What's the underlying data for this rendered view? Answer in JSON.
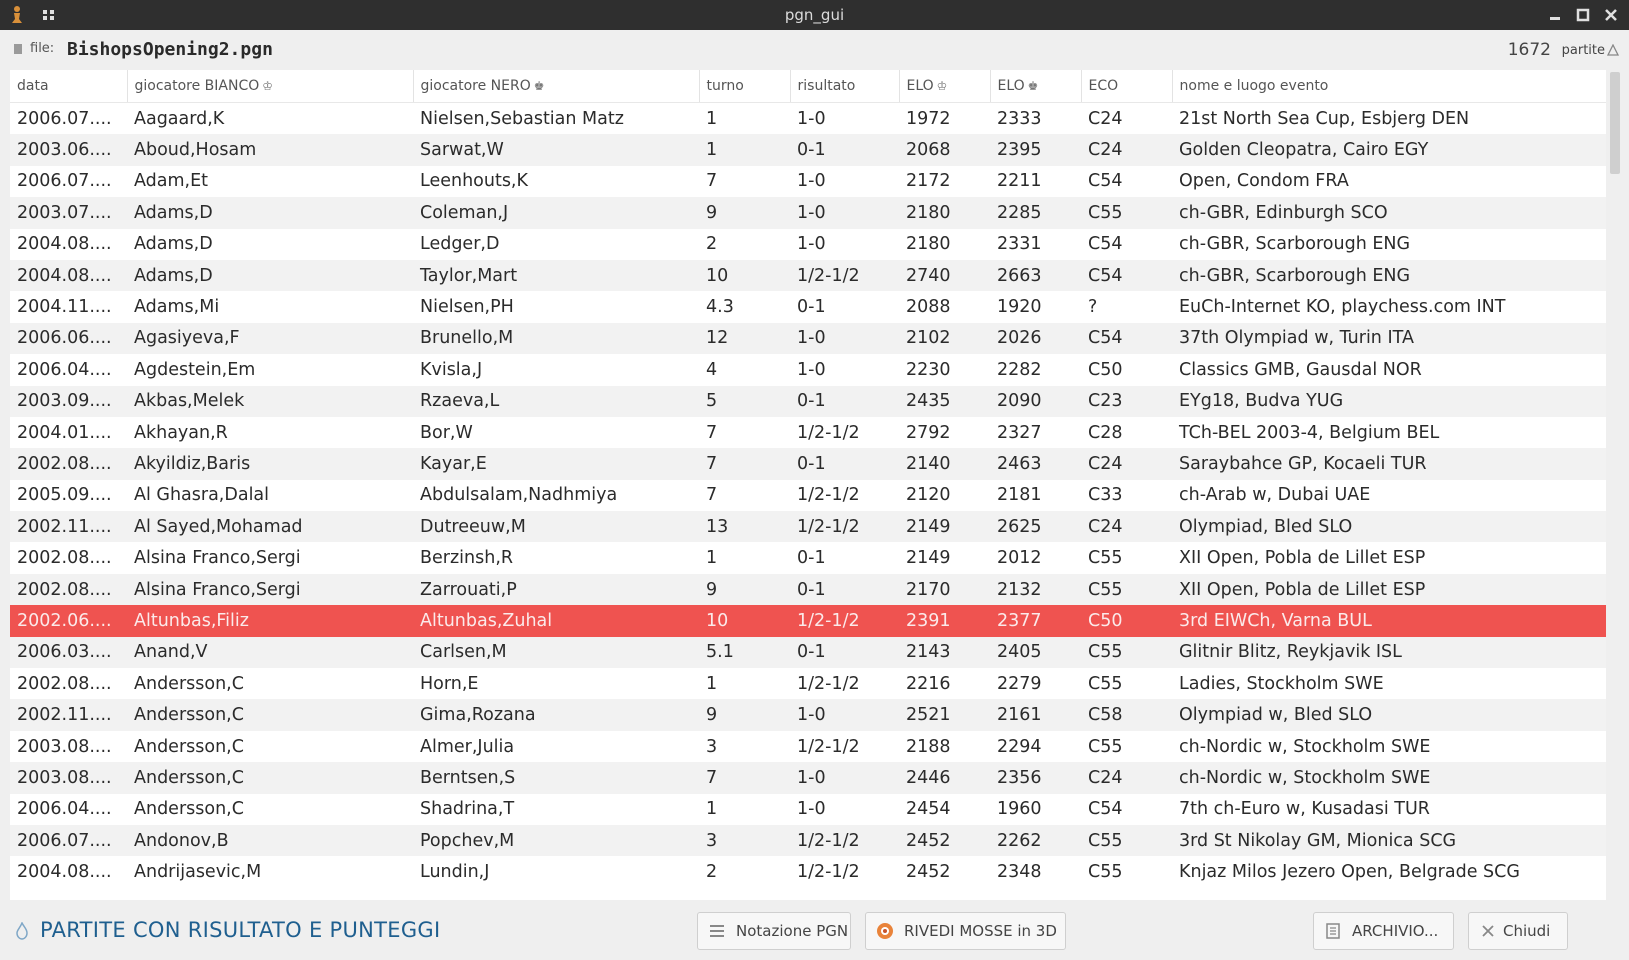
{
  "window": {
    "title": "pgn_gui"
  },
  "filebar": {
    "file_label": "file:",
    "file_name": "BishopsOpening2.pgn",
    "game_count": "1672",
    "count_label": "partite"
  },
  "table": {
    "columns": [
      {
        "label": "data",
        "icon": ""
      },
      {
        "label": "giocatore BIANCO",
        "icon": "white-king-icon"
      },
      {
        "label": "giocatore NERO",
        "icon": "black-king-icon"
      },
      {
        "label": "turno",
        "icon": ""
      },
      {
        "label": "risultato",
        "icon": ""
      },
      {
        "label": "ELO",
        "icon": "white-king-icon"
      },
      {
        "label": "ELO",
        "icon": "black-king-icon"
      },
      {
        "label": "ECO",
        "icon": ""
      },
      {
        "label": "nome e luogo evento",
        "icon": ""
      }
    ],
    "selected_index": 16,
    "rows": [
      [
        "2006.07....",
        "Aagaard,K",
        "Nielsen,Sebastian Matz",
        "1",
        "1-0",
        "1972",
        "2333",
        "C24",
        "21st North Sea Cup, Esbjerg DEN"
      ],
      [
        "2003.06....",
        "Aboud,Hosam",
        "Sarwat,W",
        "1",
        "0-1",
        "2068",
        "2395",
        "C24",
        "Golden Cleopatra, Cairo EGY"
      ],
      [
        "2006.07....",
        "Adam,Et",
        "Leenhouts,K",
        "7",
        "1-0",
        "2172",
        "2211",
        "C54",
        "Open, Condom FRA"
      ],
      [
        "2003.07....",
        "Adams,D",
        "Coleman,J",
        "9",
        "1-0",
        "2180",
        "2285",
        "C55",
        "ch-GBR, Edinburgh SCO"
      ],
      [
        "2004.08....",
        "Adams,D",
        "Ledger,D",
        "2",
        "1-0",
        "2180",
        "2331",
        "C54",
        "ch-GBR, Scarborough ENG"
      ],
      [
        "2004.08....",
        "Adams,D",
        "Taylor,Mart",
        "10",
        "1/2-1/2",
        "2740",
        "2663",
        "C54",
        "ch-GBR, Scarborough ENG"
      ],
      [
        "2004.11....",
        "Adams,Mi",
        "Nielsen,PH",
        "4.3",
        "0-1",
        "2088",
        "1920",
        "?",
        "EuCh-Internet KO, playchess.com INT"
      ],
      [
        "2006.06....",
        "Agasiyeva,F",
        "Brunello,M",
        "12",
        "1-0",
        "2102",
        "2026",
        "C54",
        "37th Olympiad w, Turin ITA"
      ],
      [
        "2006.04....",
        "Agdestein,Em",
        "Kvisla,J",
        "4",
        "1-0",
        "2230",
        "2282",
        "C50",
        "Classics GMB, Gausdal NOR"
      ],
      [
        "2003.09....",
        "Akbas,Melek",
        "Rzaeva,L",
        "5",
        "0-1",
        "2435",
        "2090",
        "C23",
        "EYg18, Budva YUG"
      ],
      [
        "2004.01....",
        "Akhayan,R",
        "Bor,W",
        "7",
        "1/2-1/2",
        "2792",
        "2327",
        "C28",
        "TCh-BEL 2003-4, Belgium BEL"
      ],
      [
        "2002.08....",
        "Akyildiz,Baris",
        "Kayar,E",
        "7",
        "0-1",
        "2140",
        "2463",
        "C24",
        "Saraybahce GP, Kocaeli TUR"
      ],
      [
        "2005.09....",
        "Al Ghasra,Dalal",
        "Abdulsalam,Nadhmiya",
        "7",
        "1/2-1/2",
        "2120",
        "2181",
        "C33",
        "ch-Arab w, Dubai UAE"
      ],
      [
        "2002.11....",
        "Al Sayed,Mohamad",
        "Dutreeuw,M",
        "13",
        "1/2-1/2",
        "2149",
        "2625",
        "C24",
        "Olympiad, Bled SLO"
      ],
      [
        "2002.08....",
        "Alsina Franco,Sergi",
        "Berzinsh,R",
        "1",
        "0-1",
        "2149",
        "2012",
        "C55",
        "XII Open, Pobla de Lillet ESP"
      ],
      [
        "2002.08....",
        "Alsina Franco,Sergi",
        "Zarrouati,P",
        "9",
        "0-1",
        "2170",
        "2132",
        "C55",
        "XII Open, Pobla de Lillet ESP"
      ],
      [
        "2002.06....",
        "Altunbas,Filiz",
        "Altunbas,Zuhal",
        "10",
        "1/2-1/2",
        "2391",
        "2377",
        "C50",
        "3rd EIWCh, Varna BUL"
      ],
      [
        "2006.03....",
        "Anand,V",
        "Carlsen,M",
        "5.1",
        "0-1",
        "2143",
        "2405",
        "C55",
        "Glitnir Blitz, Reykjavik ISL"
      ],
      [
        "2002.08....",
        "Andersson,C",
        "Horn,E",
        "1",
        "1/2-1/2",
        "2216",
        "2279",
        "C55",
        "Ladies, Stockholm SWE"
      ],
      [
        "2002.11....",
        "Andersson,C",
        "Gima,Rozana",
        "9",
        "1-0",
        "2521",
        "2161",
        "C58",
        "Olympiad w, Bled SLO"
      ],
      [
        "2003.08....",
        "Andersson,C",
        "Almer,Julia",
        "3",
        "1/2-1/2",
        "2188",
        "2294",
        "C55",
        "ch-Nordic w, Stockholm SWE"
      ],
      [
        "2003.08....",
        "Andersson,C",
        "Berntsen,S",
        "7",
        "1-0",
        "2446",
        "2356",
        "C24",
        "ch-Nordic w, Stockholm SWE"
      ],
      [
        "2006.04....",
        "Andersson,C",
        "Shadrina,T",
        "1",
        "1-0",
        "2454",
        "1960",
        "C54",
        "7th ch-Euro w, Kusadasi TUR"
      ],
      [
        "2006.07....",
        "Andonov,B",
        "Popchev,M",
        "3",
        "1/2-1/2",
        "2452",
        "2262",
        "C55",
        "3rd St Nikolay GM, Mionica SCG"
      ],
      [
        "2004.08....",
        "Andrijasevic,M",
        "Lundin,J",
        "2",
        "1/2-1/2",
        "2452",
        "2348",
        "C55",
        "Knjaz Milos Jezero Open, Belgrade SCG"
      ]
    ]
  },
  "bottombar": {
    "status_text": "PARTITE CON RISULTATO E PUNTEGGI",
    "buttons": {
      "pgn": "Notazione PGN",
      "review3d": "RIVEDI MOSSE in 3D",
      "archive": "ARCHIVIO...",
      "close": "Chiudi"
    }
  },
  "colors": {
    "selection": "#ef5350",
    "status_text": "#1f5f8f",
    "titlebar": "#2f2f2f"
  }
}
